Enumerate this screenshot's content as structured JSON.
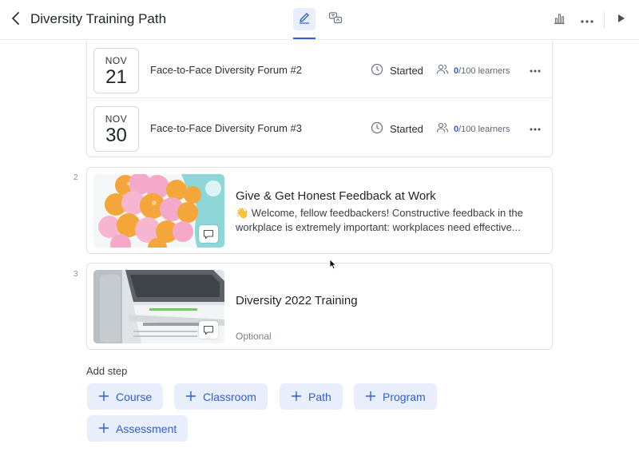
{
  "header": {
    "title": "Diversity Training Path",
    "back_icon": "chevron-left-icon",
    "tabs": [
      {
        "icon": "pencil-icon",
        "active": true
      },
      {
        "icon": "translate-icon",
        "active": false
      }
    ],
    "actions": [
      "bar-chart-icon",
      "more-icon",
      "play-icon"
    ]
  },
  "sessions": [
    {
      "month": "NOV",
      "day": "21",
      "name": "Face-to-Face Diversity Forum #2",
      "status": "Started",
      "learners_count": "0",
      "learners_suffix": "/100 learners"
    },
    {
      "month": "NOV",
      "day": "30",
      "name": "Face-to-Face Diversity Forum #3",
      "status": "Started",
      "learners_count": "0",
      "learners_suffix": "/100 learners"
    }
  ],
  "steps": [
    {
      "number": "2",
      "title": "Give & Get Honest Feedback at Work",
      "desc_line1": "👋 Welcome, fellow feedbackers! Constructive feedback in the",
      "desc_line2": "workplace is extremely important: workplaces need effective...",
      "thumbnail": "balloons-image"
    },
    {
      "number": "3",
      "title": "Diversity 2022 Training",
      "optional": "Optional",
      "thumbnail": "laptop-image"
    }
  ],
  "add_step": {
    "label": "Add step",
    "options": [
      "Course",
      "Classroom",
      "Path",
      "Program",
      "Assessment"
    ]
  },
  "colors": {
    "accent": "#2f5fd0",
    "chip_bg": "#e8eefb",
    "border": "#dfe3e8"
  }
}
